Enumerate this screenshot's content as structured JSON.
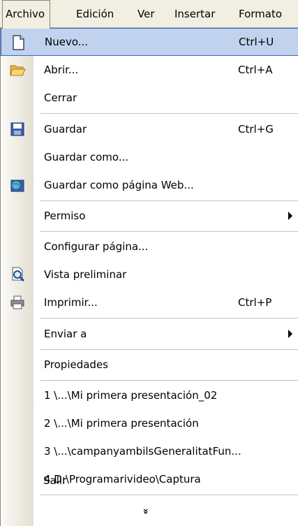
{
  "menubar": {
    "items": [
      {
        "label": "Archivo"
      },
      {
        "label": "Edición"
      },
      {
        "label": "Ver"
      },
      {
        "label": "Insertar"
      },
      {
        "label": "Formato"
      }
    ]
  },
  "menu": {
    "items": [
      {
        "label": "Nuevo...",
        "shortcut": "Ctrl+U",
        "icon": "new-document-icon"
      },
      {
        "label": "Abrir...",
        "shortcut": "Ctrl+A",
        "icon": "open-folder-icon"
      },
      {
        "label": "Cerrar"
      },
      {
        "label": "Guardar",
        "shortcut": "Ctrl+G",
        "icon": "save-disk-icon"
      },
      {
        "label": "Guardar como..."
      },
      {
        "label": "Guardar como página Web...",
        "icon": "save-web-icon"
      },
      {
        "label": "Permiso",
        "submenu": true
      },
      {
        "label": "Configurar página..."
      },
      {
        "label": "Vista preliminar",
        "icon": "print-preview-icon"
      },
      {
        "label": "Imprimir...",
        "shortcut": "Ctrl+P",
        "icon": "printer-icon"
      },
      {
        "label": "Enviar a",
        "submenu": true
      },
      {
        "label": "Propiedades"
      },
      {
        "label": "1 \\...\\Mi primera presentación_02"
      },
      {
        "label": "2 \\...\\Mi primera presentación"
      },
      {
        "label": "3 \\...\\campanyambilsGeneralitatFun..."
      },
      {
        "label": "4 D:\\Programarivideo\\Captura"
      },
      {
        "label": "Salir"
      }
    ],
    "more_glyph": "»"
  },
  "colors": {
    "highlight": "#c1d2ee",
    "highlight_border": "#316ac5",
    "menubar": "#f1efe2"
  }
}
